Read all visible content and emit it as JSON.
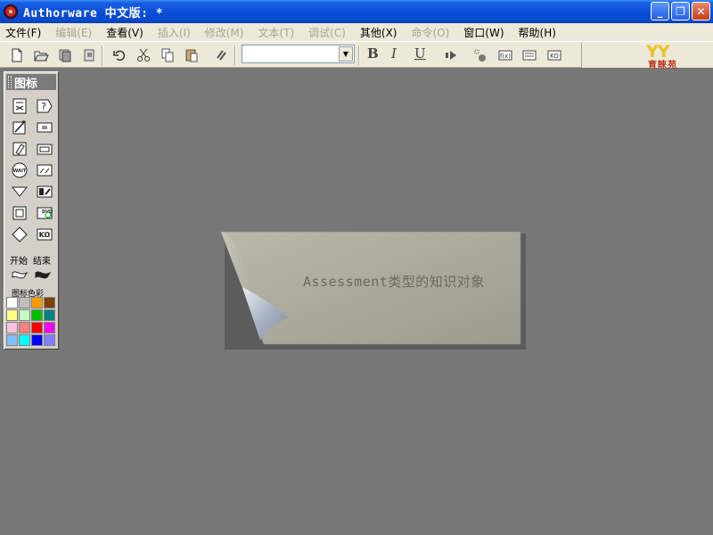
{
  "window": {
    "title": "Authorware 中文版: *",
    "minimize_glyph": "_",
    "maximize_glyph": "❐",
    "close_glyph": "✕"
  },
  "menu": [
    {
      "label": "文件(F)",
      "enabled": true
    },
    {
      "label": "编辑(E)",
      "enabled": false
    },
    {
      "label": "查看(V)",
      "enabled": true
    },
    {
      "label": "插入(I)",
      "enabled": false
    },
    {
      "label": "修改(M)",
      "enabled": false
    },
    {
      "label": "文本(T)",
      "enabled": false
    },
    {
      "label": "调试(C)",
      "enabled": false
    },
    {
      "label": "其他(X)",
      "enabled": true
    },
    {
      "label": "命令(O)",
      "enabled": false
    },
    {
      "label": "窗口(W)",
      "enabled": true
    },
    {
      "label": "帮助(H)",
      "enabled": true
    }
  ],
  "toolbar": {
    "font_value": "",
    "bold": "B",
    "italic": "I",
    "underline": "U",
    "logo_mark": "YY",
    "logo_text": "育睞苑"
  },
  "palette": {
    "title": "图标",
    "start_label": "开始",
    "end_label": "结束",
    "colors_label": "图标色彩",
    "swatches": [
      "#ffffff",
      "#c0c0c0",
      "#ff9900",
      "#804000",
      "#ffff80",
      "#c0ffc0",
      "#00c000",
      "#008080",
      "#ffc0e0",
      "#ff8080",
      "#ff0000",
      "#ff00ff",
      "#80c0ff",
      "#00ffff",
      "#0000ff",
      "#8080ff"
    ]
  },
  "stage": {
    "note_text": "Assessment类型的知识对象"
  }
}
